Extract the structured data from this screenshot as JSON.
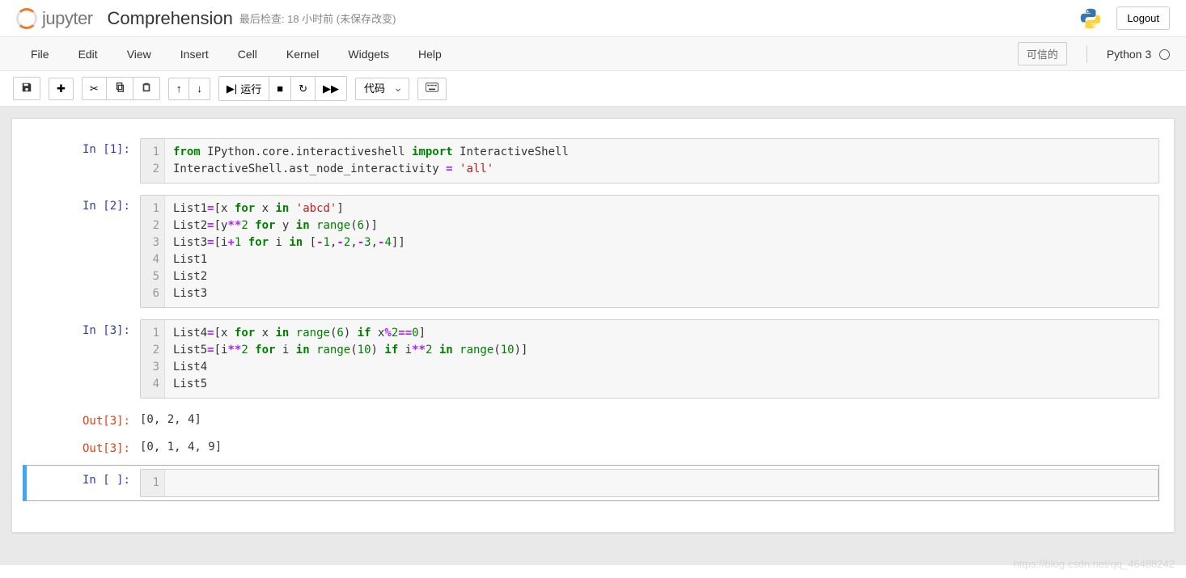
{
  "header": {
    "logo_text": "jupyter",
    "title": "Comprehension",
    "checkpoint": "最后检查: 18 小时前  (未保存改变)",
    "logout": "Logout"
  },
  "menu": {
    "items": [
      "File",
      "Edit",
      "View",
      "Insert",
      "Cell",
      "Kernel",
      "Widgets",
      "Help"
    ],
    "trusted": "可信的",
    "kernel": "Python 3"
  },
  "toolbar": {
    "run_label": "运行",
    "celltype": "代码"
  },
  "cells": [
    {
      "prompt": "In [1]:",
      "gutter": "1\n2",
      "code_html": "<span class='kw'>from</span> IPython.core.interactiveshell <span class='kw'>import</span> InteractiveShell\nInteractiveShell.ast_node_interactivity <span class='op'>=</span> <span class='str'>'all'</span>"
    },
    {
      "prompt": "In [2]:",
      "gutter": "1\n2\n3\n4\n5\n6",
      "code_html": "List1<span class='op'>=</span>[x <span class='kw'>for</span> x <span class='kw'>in</span> <span class='str'>'abcd'</span>]\nList2<span class='op'>=</span>[y<span class='op'>**</span><span class='num'>2</span> <span class='kw'>for</span> y <span class='kw'>in</span> <span class='bi'>range</span>(<span class='num'>6</span>)]\nList3<span class='op'>=</span>[i<span class='op'>+</span><span class='num'>1</span> <span class='kw'>for</span> i <span class='kw'>in</span> [<span class='op'>-</span><span class='num'>1</span>,<span class='op'>-</span><span class='num'>2</span>,<span class='op'>-</span><span class='num'>3</span>,<span class='op'>-</span><span class='num'>4</span>]]\nList1\nList2\nList3"
    },
    {
      "prompt": "In [3]:",
      "gutter": "1\n2\n3\n4",
      "code_html": "List4<span class='op'>=</span>[x <span class='kw'>for</span> x <span class='kw'>in</span> <span class='bi'>range</span>(<span class='num'>6</span>) <span class='kw'>if</span> x<span class='op'>%</span><span class='num'>2</span><span class='op'>==</span><span class='num'>0</span>]\nList5<span class='op'>=</span>[i<span class='op'>**</span><span class='num'>2</span> <span class='kw'>for</span> i <span class='kw'>in</span> <span class='bi'>range</span>(<span class='num'>10</span>) <span class='kw'>if</span> i<span class='op'>**</span><span class='num'>2</span> <span class='kw'>in</span> <span class='bi'>range</span>(<span class='num'>10</span>)]\nList4\nList5",
      "outputs": [
        {
          "prompt": "Out[3]:",
          "text": "[0, 2, 4]"
        },
        {
          "prompt": "Out[3]:",
          "text": "[0, 1, 4, 9]"
        }
      ]
    },
    {
      "prompt": "In [ ]:",
      "gutter": "1",
      "code_html": "",
      "selected": true
    }
  ],
  "watermark": "https://blog.csdn.net/qq_46488242"
}
